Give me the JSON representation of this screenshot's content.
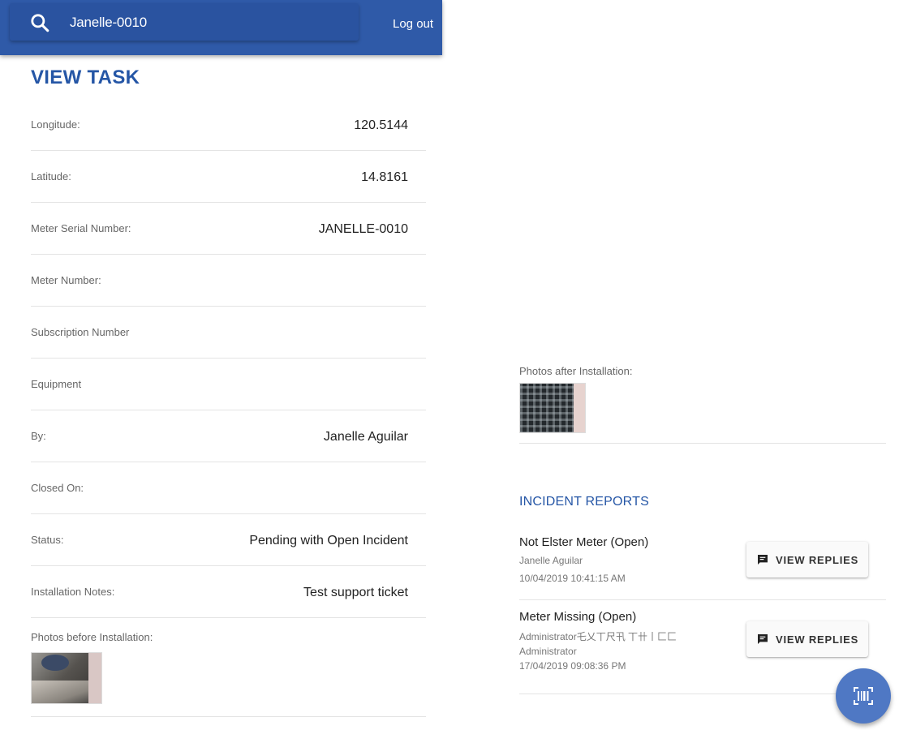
{
  "header": {
    "search_value": "Janelle-0010",
    "logout_label": "Log out",
    "colors": {
      "bar": "#2f5aa8",
      "accent": "#2556a6"
    }
  },
  "page": {
    "title": "VIEW TASK"
  },
  "fields": [
    {
      "label": "Longitude:",
      "value": "120.5144"
    },
    {
      "label": "Latitude:",
      "value": "14.8161"
    },
    {
      "label": "Meter Serial Number:",
      "value": "JANELLE-0010"
    },
    {
      "label": "Meter Number:",
      "value": ""
    },
    {
      "label": "Subscription Number",
      "value": ""
    },
    {
      "label": "Equipment",
      "value": ""
    },
    {
      "label": "By:",
      "value": "Janelle Aguilar"
    },
    {
      "label": "Closed On:",
      "value": ""
    },
    {
      "label": "Status:",
      "value": "Pending with Open Incident"
    },
    {
      "label": "Installation Notes:",
      "value": "Test support ticket"
    }
  ],
  "photos": {
    "before_label": "Photos before Installation:",
    "after_label": "Photos after Installation:"
  },
  "incidents": {
    "title": "INCIDENT REPORTS",
    "items": [
      {
        "heading": "Not Elster Meter (Open)",
        "author": "Janelle Aguilar",
        "subline": "",
        "timestamp": "10/04/2019 10:41:15 AM",
        "button_label": "VIEW REPLIES"
      },
      {
        "heading": "Meter Missing (Open)",
        "author": "Administrator乇乂丅尺卂 丅卄丨匚匚",
        "subline": "Administrator",
        "timestamp": "17/04/2019 09:08:36 PM",
        "button_label": "VIEW REPLIES"
      }
    ]
  },
  "icons": {
    "search": "search-icon",
    "chat": "chat-icon",
    "barcode": "barcode-scan-icon"
  }
}
